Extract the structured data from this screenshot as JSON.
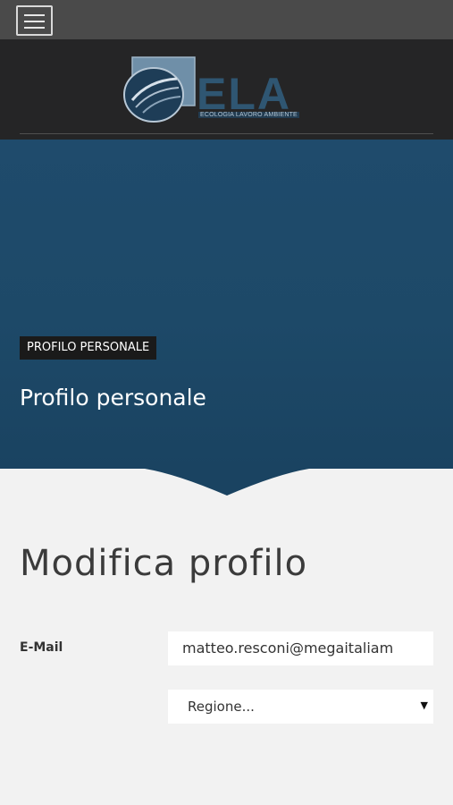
{
  "topbar": {
    "menu_icon": "hamburger-icon"
  },
  "header": {
    "logo_text": "ELA",
    "logo_subtext": "ECOLOGIA LAVORO AMBIENTE"
  },
  "hero": {
    "breadcrumb": "PROFILO PERSONALE",
    "title": "Profilo personale"
  },
  "main": {
    "title": "Modifica profilo",
    "email_label": "E-Mail",
    "email_value": "matteo.resconi@megaitaliam",
    "region_placeholder": "Regione...",
    "region_arrow": "▼"
  },
  "colors": {
    "topbar": "#4a4a4a",
    "header": "#252526",
    "hero": "#1f4b6c",
    "page": "#f2f2f2"
  }
}
